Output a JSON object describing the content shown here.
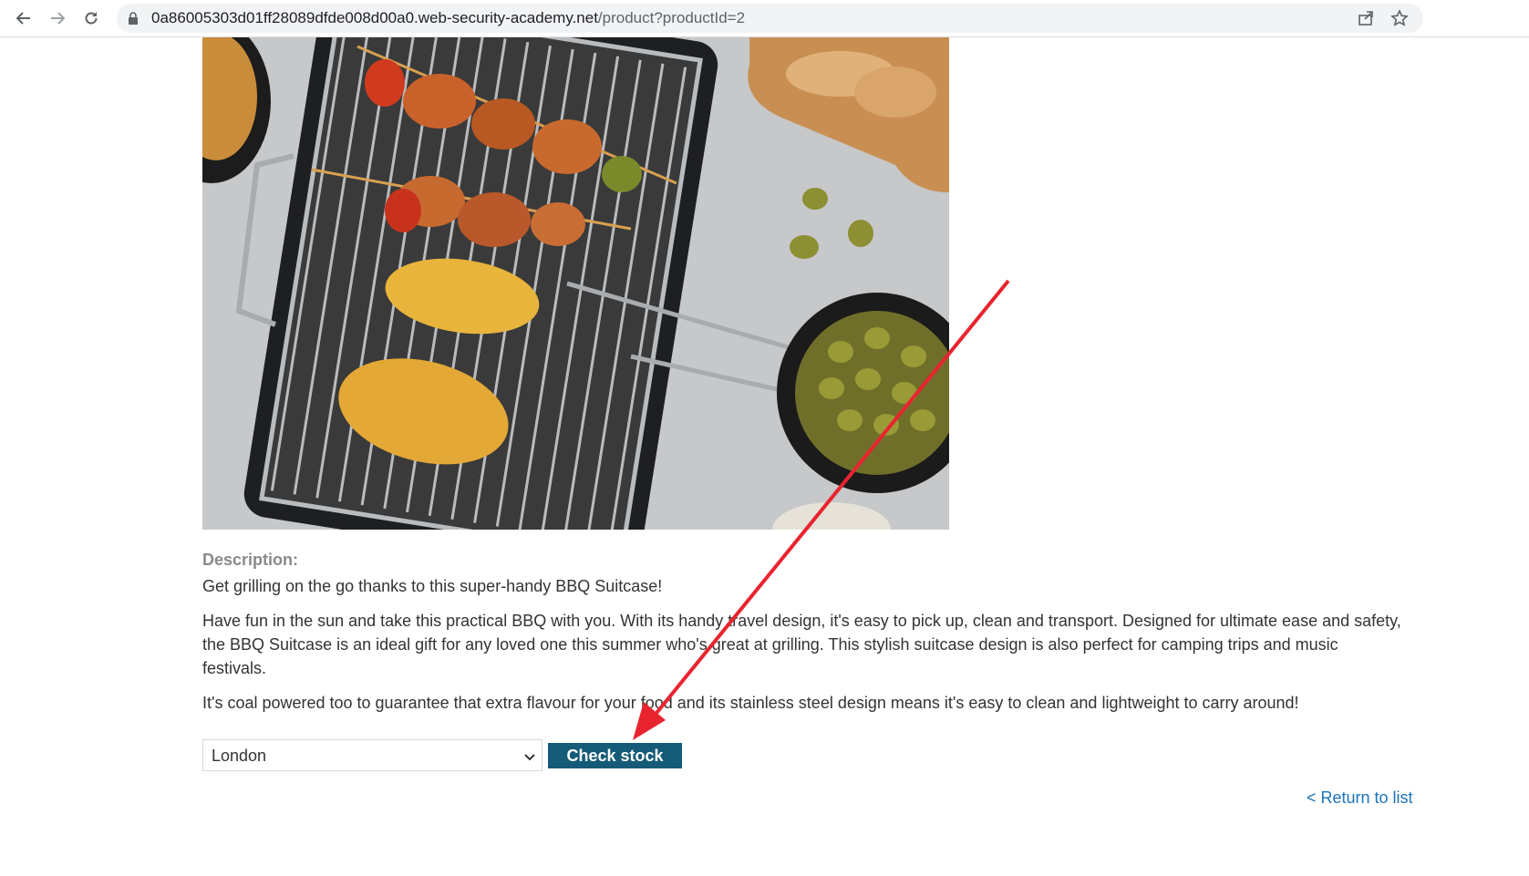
{
  "browser": {
    "url_host": "0a86005303d01ff28089dfde008d00a0.web-security-academy.net",
    "url_path": "/product?productId=2",
    "icons": [
      "back-icon",
      "forward-icon",
      "reload-icon",
      "lock-icon",
      "share-icon",
      "star-icon"
    ]
  },
  "product": {
    "image_icon": "bbq-suitcase-photo"
  },
  "description": {
    "label": "Description:",
    "tagline": "Get grilling on the go thanks to this super-handy BBQ Suitcase!",
    "paragraph1": "Have fun in the sun and take this practical BBQ with you. With its handy travel design, it's easy to pick up, clean and transport. Designed for ultimate ease and safety, the BBQ Suitcase is an ideal gift for any loved one this summer who's great at grilling. This stylish suitcase design is also perfect for camping trips and music festivals.",
    "paragraph2": "It's coal powered too to guarantee that extra flavour for your food and its stainless steel design means it's easy to clean and lightweight to carry around!"
  },
  "stock": {
    "selected_store": "London",
    "check_label": "Check stock"
  },
  "footer": {
    "return_label": "< Return to list"
  },
  "colors": {
    "button": "#155b77",
    "link": "#1b73b9",
    "annotation_arrow": "#e8242f"
  }
}
